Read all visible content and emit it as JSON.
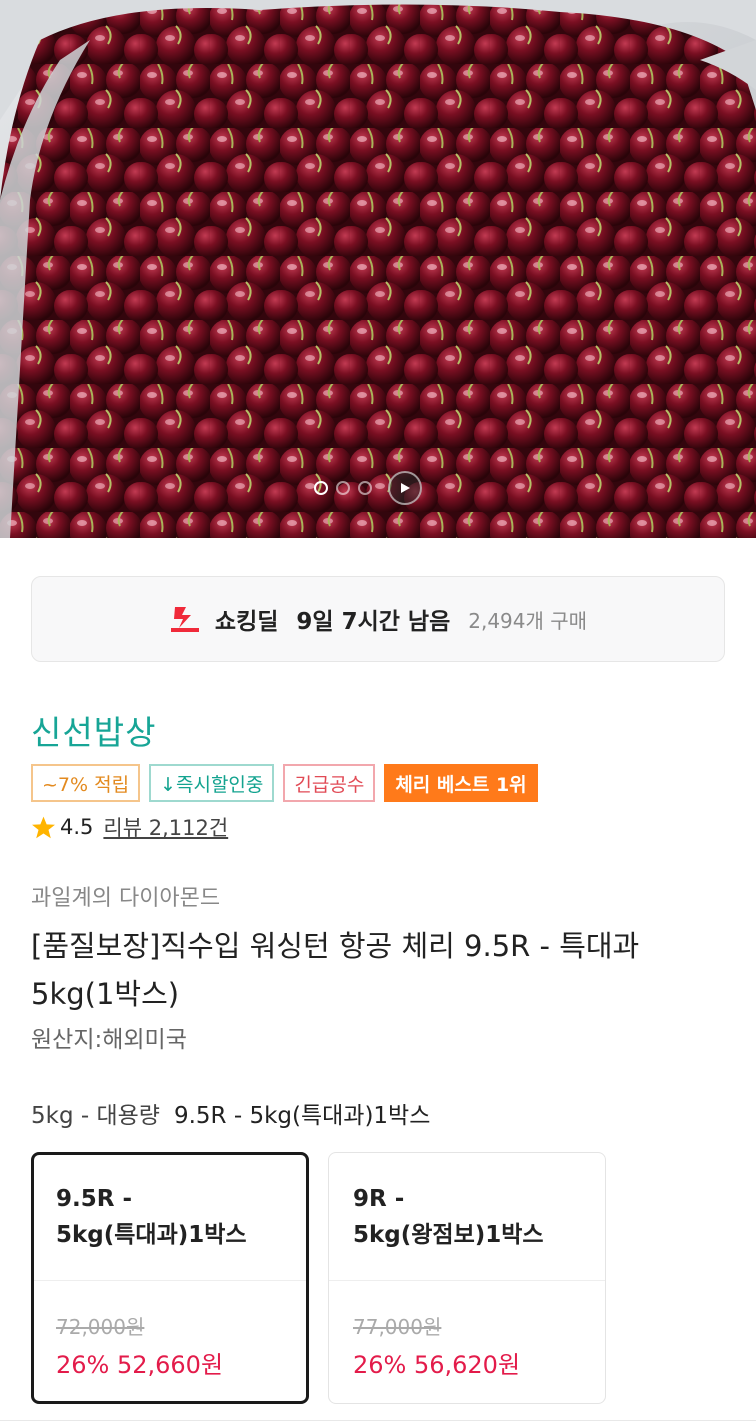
{
  "hero": {
    "image_desc_icon": "cherries-photo",
    "carousel": {
      "total": 3,
      "active": 1
    },
    "play_icon": "play-icon"
  },
  "deal": {
    "icon": "bolt-icon",
    "label": "쇼킹딜",
    "remaining": "9일 7시간 남음",
    "purchases": "2,494개 구매"
  },
  "store": {
    "name": "신선밥상"
  },
  "badges": [
    "~7% 적립",
    "↓즉시할인중",
    "긴급공수",
    "체리 베스트 1위"
  ],
  "rating": {
    "score": "4.5",
    "review_link": "리뷰 2,112건"
  },
  "product": {
    "slogan": "과일계의 다이아몬드",
    "title_line1": "[품질보장]직수입 워싱턴 항공 체리 9.5R - 특대과",
    "title_line2": "5kg(1박스)",
    "origin": "원산지:해외미국"
  },
  "options": {
    "header_label": "5kg - 대용량",
    "header_selected": "9.5R - 5kg(특대과)1박스",
    "cards": [
      {
        "line1": "9.5R -",
        "line2": "5kg(특대과)1박스",
        "original_price": "72,000원",
        "sale": "26% 52,660원",
        "selected": true
      },
      {
        "line1": "9R -",
        "line2": "5kg(왕점보)1박스",
        "original_price": "77,000원",
        "sale": "26% 56,620원",
        "selected": false
      }
    ]
  },
  "colors": {
    "accent_teal": "#17a596",
    "price_red": "#e31b4a",
    "best_orange": "#ff7a1a"
  }
}
